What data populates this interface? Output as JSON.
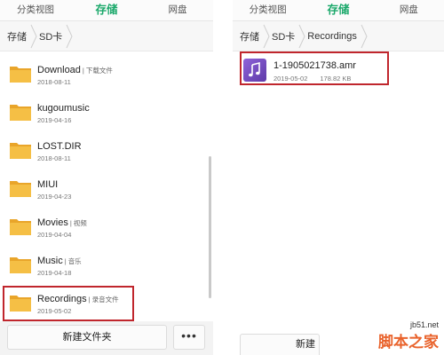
{
  "left": {
    "tabs": [
      "分类视图",
      "存储",
      "网盘"
    ],
    "breadcrumb": [
      "存储",
      "SD卡"
    ],
    "items": [
      {
        "name": "Download",
        "tag": "下载文件",
        "date": "2018-08-11"
      },
      {
        "name": "kugoumusic",
        "tag": "",
        "date": "2019-04-16"
      },
      {
        "name": "LOST.DIR",
        "tag": "",
        "date": "2018-08-11"
      },
      {
        "name": "MIUI",
        "tag": "",
        "date": "2019-04-23"
      },
      {
        "name": "Movies",
        "tag": "视频",
        "date": "2019-04-04"
      },
      {
        "name": "Music",
        "tag": "音乐",
        "date": "2019-04-18"
      },
      {
        "name": "Recordings",
        "tag": "录音文件",
        "date": "2019-05-02"
      }
    ],
    "new_folder_label": "新建文件夹",
    "more_label": "•••"
  },
  "right": {
    "tabs": [
      "分类视图",
      "存储",
      "网盘"
    ],
    "breadcrumb": [
      "存储",
      "SD卡",
      "Recordings"
    ],
    "file": {
      "name": "1-1905021738.amr",
      "date": "2019-05-02",
      "size": "178.82 KB"
    },
    "bottom_label": "新建"
  },
  "watermark": {
    "url": "jb51.net",
    "logo": "脚本之家"
  },
  "colors": {
    "accent": "#1aa86a",
    "highlight": "#c0262d",
    "folder": "#f2b73a",
    "music_icon": "#7a4fc5"
  }
}
